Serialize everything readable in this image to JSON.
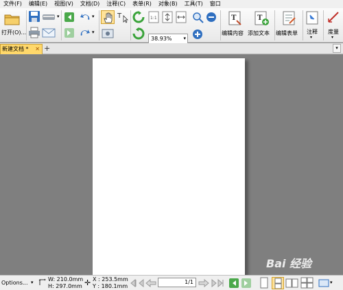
{
  "menu": [
    "文件(F)",
    "编辑(E)",
    "视图(V)",
    "文档(D)",
    "注释(C)",
    "表单(R)",
    "对象(B)",
    "工具(T)",
    "窗口"
  ],
  "toolbar": {
    "open_label": "打开(O)...",
    "zoom_value": "38.93%",
    "edit_content_label": "编辑内容",
    "add_text_label": "添加文本",
    "edit_form_label": "编辑表单",
    "annotation_label": "注释",
    "measure_label": "度量"
  },
  "tab": {
    "title": "新建文档 *",
    "close": "✕",
    "add": "+"
  },
  "status": {
    "options_label": "Options...",
    "width": "W: 210.0mm",
    "height": "H: 297.0mm",
    "x": "X : 253.5mm",
    "y": "Y : 180.1mm",
    "page": "1/1"
  },
  "watermark": "Bai 经验",
  "colors": {
    "tab_active": "#ffd86b",
    "workspace": "#7f7f7f",
    "accent_green": "#3aa33a",
    "accent_blue": "#2f6fc0"
  }
}
